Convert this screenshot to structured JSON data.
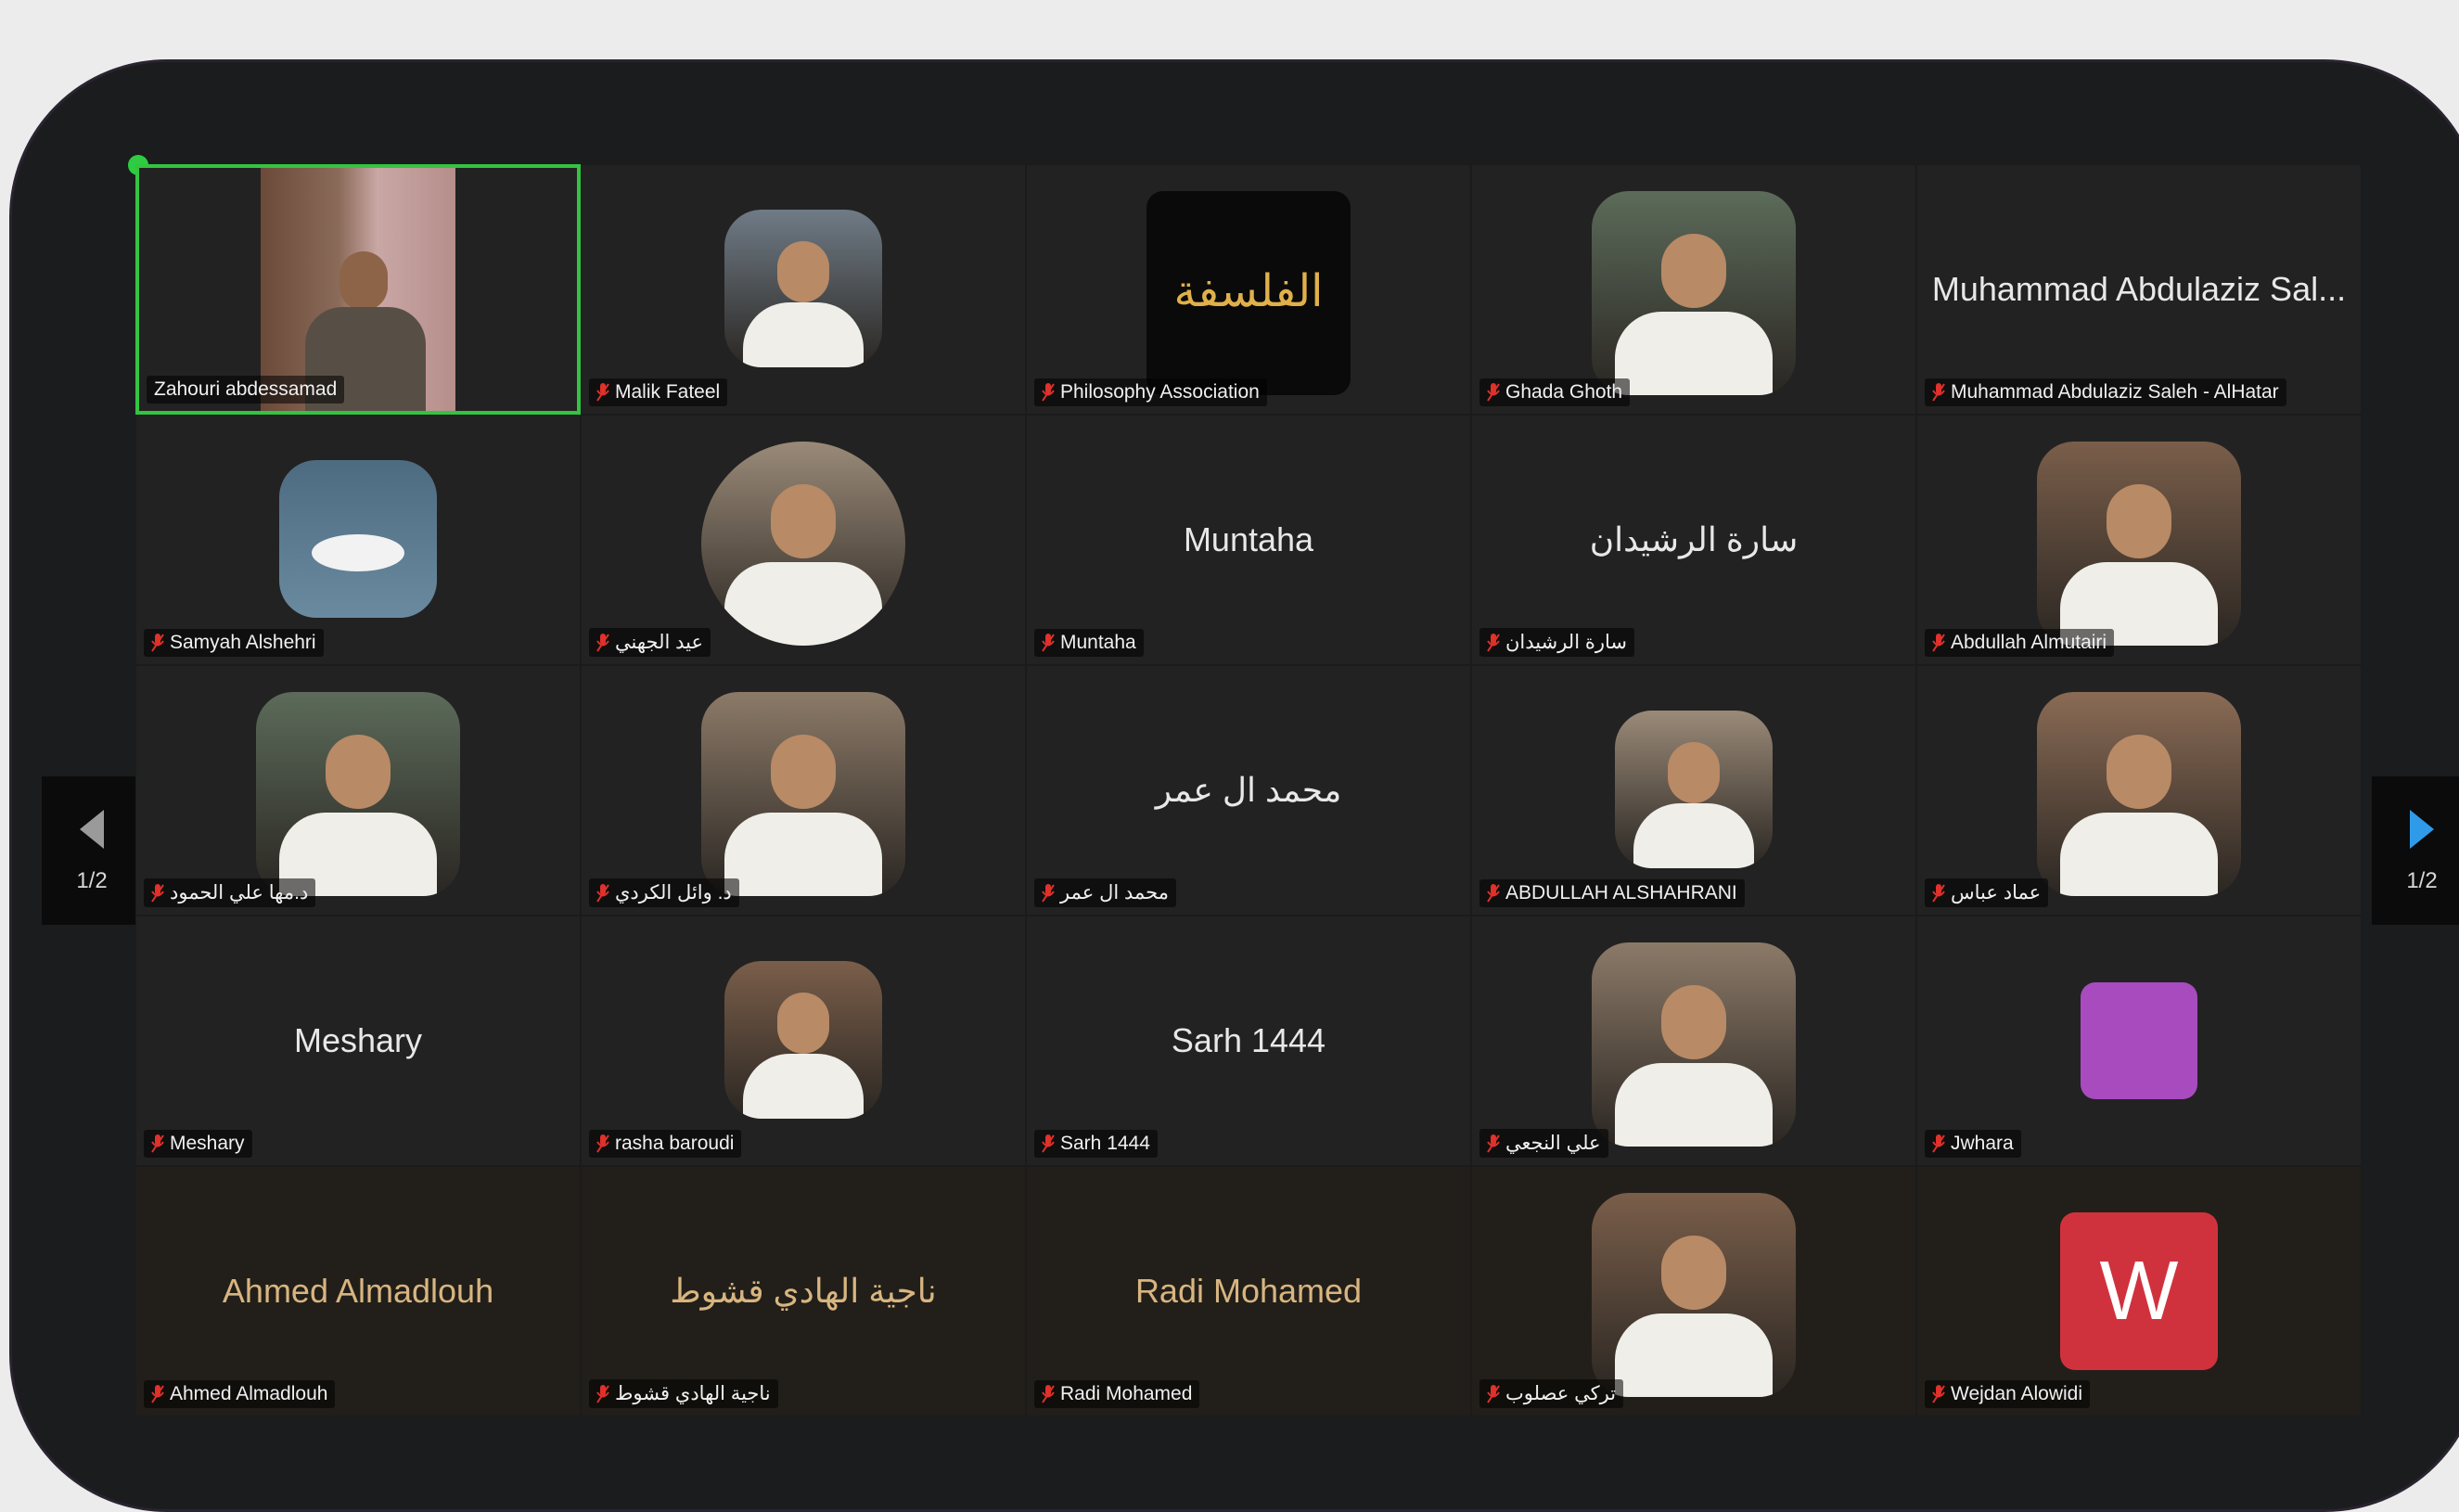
{
  "paging": {
    "left_label": "1/2",
    "right_label": "1/2"
  },
  "tiles": [
    {
      "label": "Zahouri abdessamad",
      "big": "",
      "type": "video"
    },
    {
      "label": "Malik Fateel",
      "big": "",
      "type": "photo"
    },
    {
      "label": "Philosophy Association",
      "big": "",
      "type": "logo",
      "logo_text": "الفلسفة"
    },
    {
      "label": "Ghada Ghoth",
      "big": "",
      "type": "photo"
    },
    {
      "label": "Muhammad Abdulaziz Saleh - AlHatar",
      "big": "Muhammad Abdulaziz Sal...",
      "type": "name"
    },
    {
      "label": "Samyah Alshehri",
      "big": "",
      "type": "swan"
    },
    {
      "label": "عيد الجهني",
      "big": "",
      "type": "photo"
    },
    {
      "label": "Muntaha",
      "big": "Muntaha",
      "type": "name"
    },
    {
      "label": "سارة الرشيدان",
      "big": "سارة الرشيدان",
      "type": "name"
    },
    {
      "label": "Abdullah Almutairi",
      "big": "",
      "type": "photo"
    },
    {
      "label": "د.مها علي الحمود",
      "big": "",
      "type": "photo"
    },
    {
      "label": "د. وائل الكردي",
      "big": "",
      "type": "photo"
    },
    {
      "label": "محمد ال عمر",
      "big": "محمد ال عمر",
      "type": "name"
    },
    {
      "label": "ABDULLAH ALSHAHRANI",
      "big": "",
      "type": "photo"
    },
    {
      "label": "عماد عباس",
      "big": "",
      "type": "photo"
    },
    {
      "label": "Meshary",
      "big": "Meshary",
      "type": "name"
    },
    {
      "label": "rasha baroudi",
      "big": "",
      "type": "photo"
    },
    {
      "label": "Sarh 1444",
      "big": "Sarh 1444",
      "type": "name"
    },
    {
      "label": "علي النجعي",
      "big": "",
      "type": "photo"
    },
    {
      "label": "Jwhara",
      "big": "",
      "type": "square",
      "color": "#a84bbf"
    },
    {
      "label": "Ahmed Almadlouh",
      "big": "Ahmed Almadlouh",
      "type": "name"
    },
    {
      "label": "ناجية الهادي قشوط",
      "big": "ناجية الهادي قشوط",
      "type": "name"
    },
    {
      "label": "Radi Mohamed",
      "big": "Radi Mohamed",
      "type": "name"
    },
    {
      "label": "تركي عصلوب",
      "big": "",
      "type": "photo"
    },
    {
      "label": "Wejdan Alowidi",
      "big": "",
      "type": "letter",
      "letter": "W",
      "color": "#d0323d"
    }
  ]
}
